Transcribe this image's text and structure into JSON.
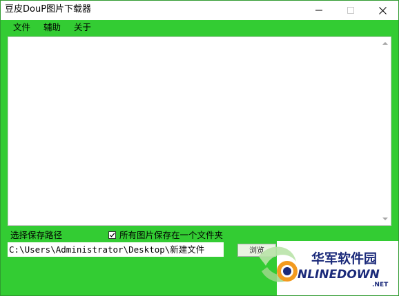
{
  "window": {
    "title": "豆皮DouP图片下载器",
    "controls": {
      "minimize_icon": "minimize-icon",
      "maximize_icon": "maximize-icon",
      "close_icon": "close-icon"
    }
  },
  "menu": {
    "items": [
      {
        "label": "文件"
      },
      {
        "label": "辅助"
      },
      {
        "label": "关于"
      }
    ]
  },
  "main": {
    "list_items": []
  },
  "footer": {
    "save_path_label": "选择保存路径",
    "single_folder_checkbox": {
      "label": "所有图片保存在一个文件夹",
      "checked": true
    },
    "path_value": "C:\\Users\\Administrator\\Desktop\\新建文件",
    "browse_label": "浏览"
  },
  "watermark": {
    "cn_text": "华军软件园",
    "en_text": "NLINEDOWN",
    "tld": ".NET",
    "colors": {
      "navy": "#1b2a7a",
      "orange": "#f29a1f",
      "green_swirl": "#b9e3a8"
    }
  },
  "colors": {
    "window_bg": "#33cc33",
    "titlebar_bg": "#ffffff",
    "list_bg": "#ffffff"
  }
}
